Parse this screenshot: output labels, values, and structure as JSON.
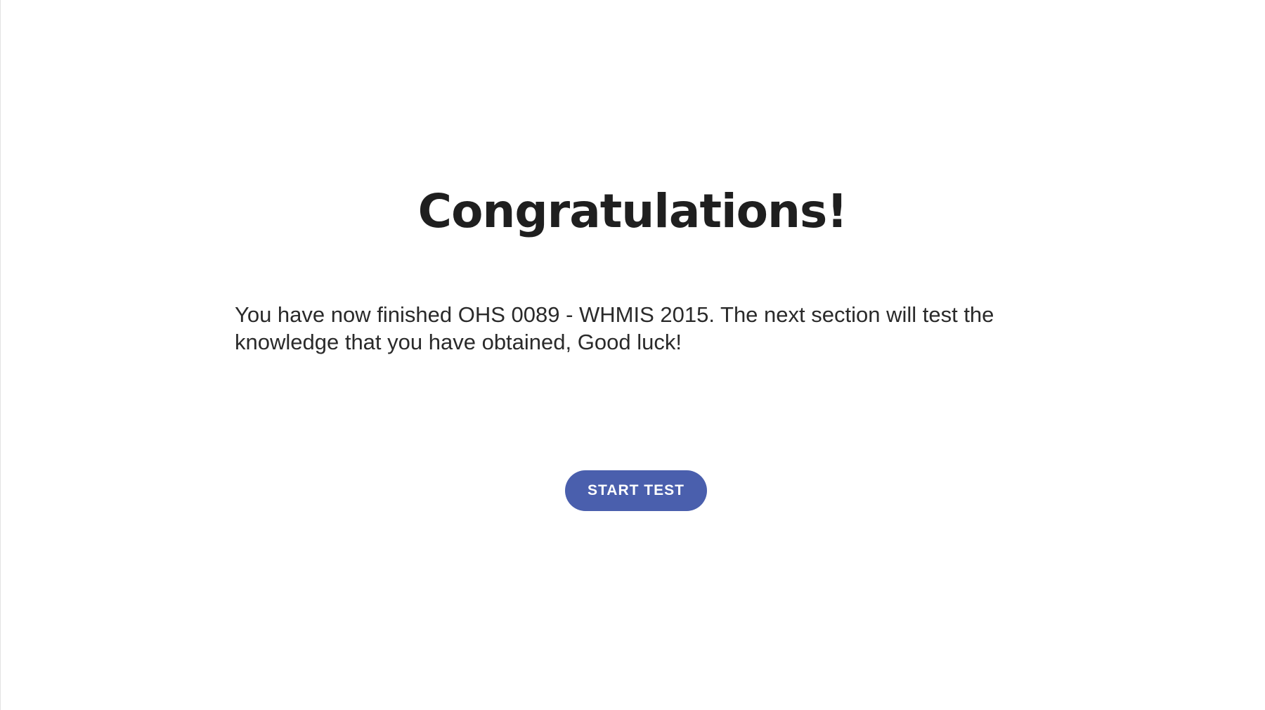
{
  "completion": {
    "heading": "Congratulations!",
    "message": "You have now finished OHS 0089 - WHMIS 2015. The next section will test the knowledge that you have obtained, Good luck!",
    "start_button_label": "START TEST"
  },
  "colors": {
    "background": "#ffffff",
    "heading_text": "#1f1f1f",
    "body_text": "#2a2a2a",
    "button_background": "#4a5fad",
    "button_text": "#ffffff"
  }
}
